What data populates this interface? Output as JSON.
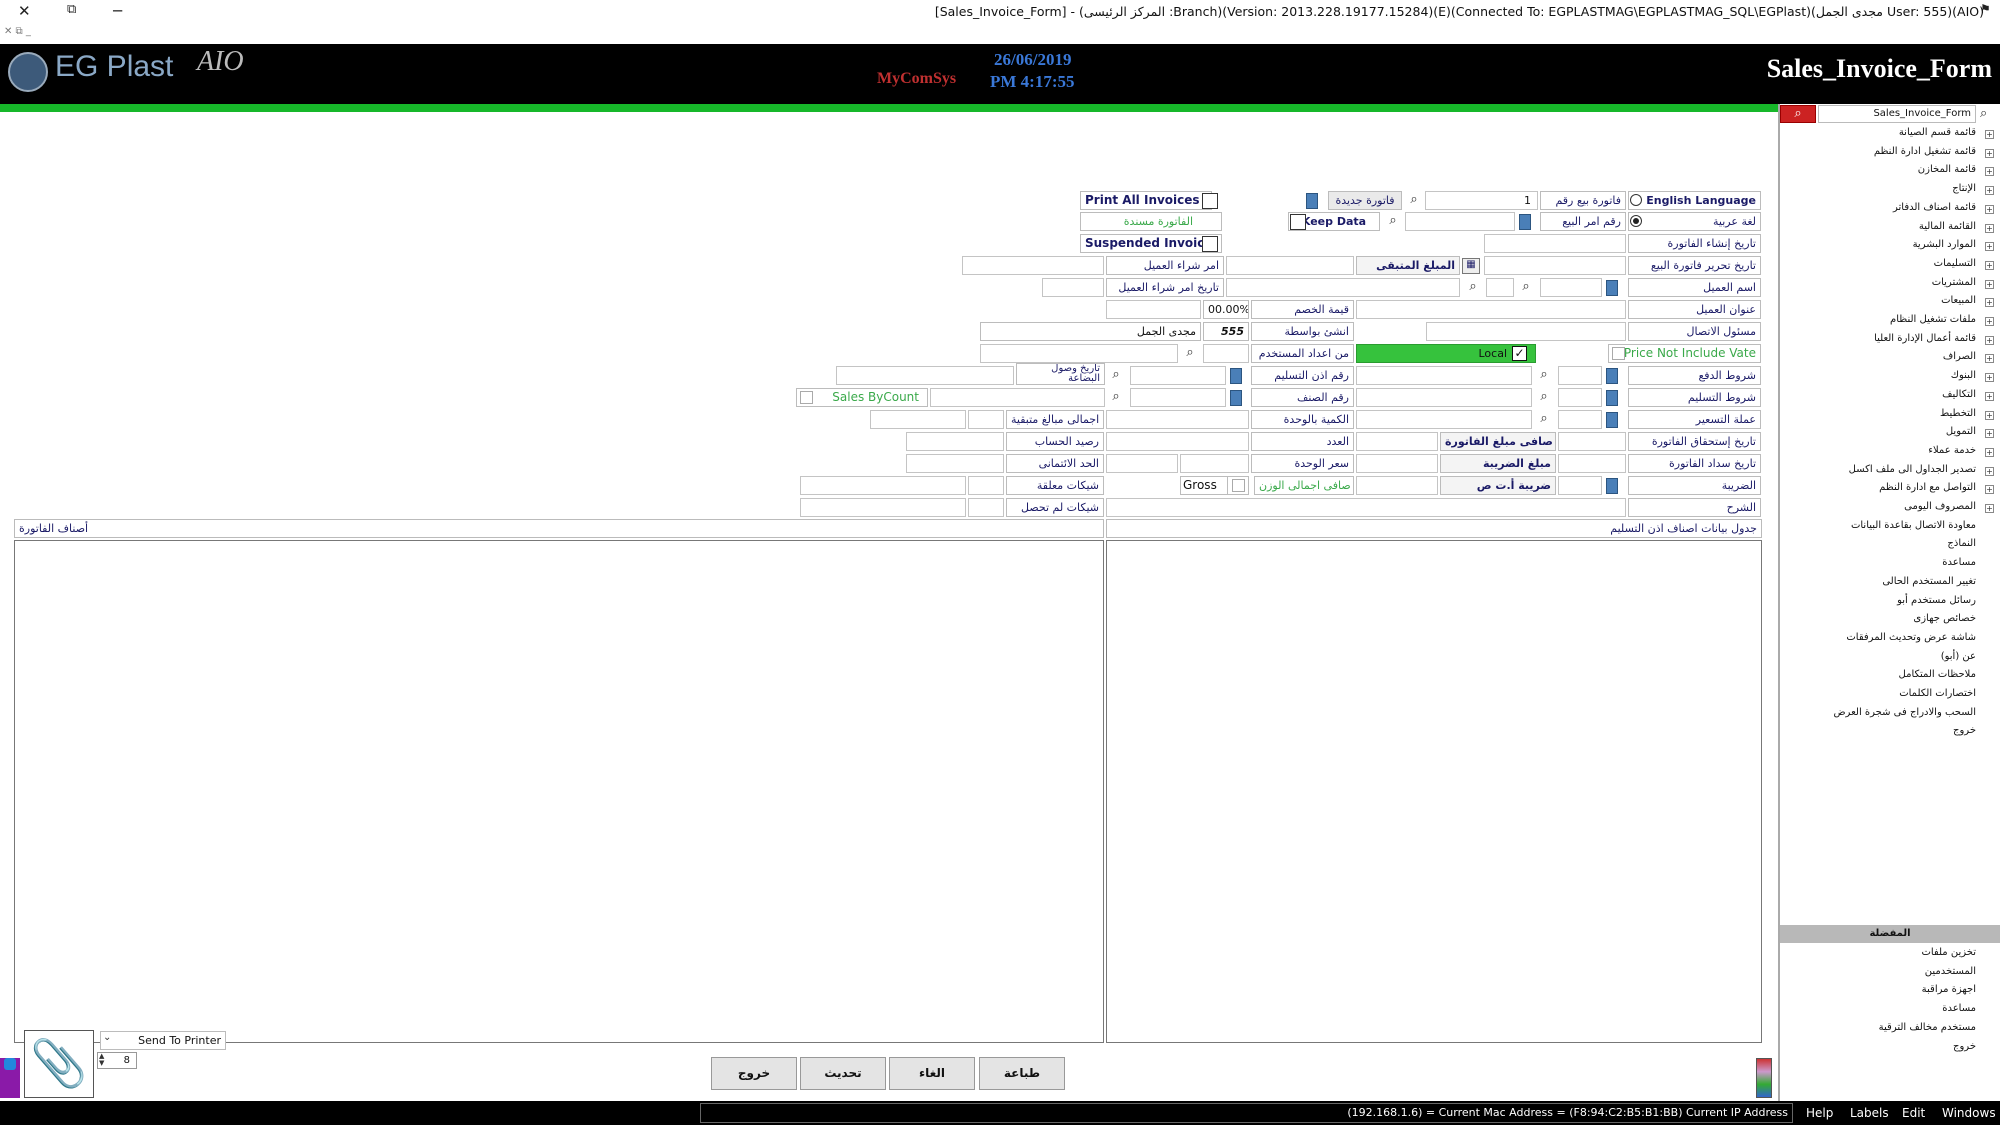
{
  "window": {
    "title": "[Sales_Invoice_Form] - (المركز الرئيسى :Branch)(Version: 2013.228.19177.15284)(E)(Connected To: EGPLASTMAG\\EGPLASTMAG_SQL\\EGPlast)(مجدى الجمل User: 555)(AIO)"
  },
  "header": {
    "logo": "EG Plast",
    "logo_suffix": "AIO",
    "brand2": "MyComSys",
    "date": "26/06/2019",
    "time": "PM 4:17:55",
    "form_title": "Sales_Invoice_Form"
  },
  "colors": {
    "accent_green": "#17b82a",
    "banner": "#000000",
    "date_blue": "#3a78d8"
  },
  "form": {
    "english_language": "English Language",
    "arabic_language": "لغة عربية",
    "invoice_no_label": "فاتورة بيع رقم",
    "invoice_no_value": "1",
    "order_no_label": "رقم امر البيع",
    "new_invoice": "فاتورة جديدة",
    "keep_data": "Keep Data",
    "print_all": "Print All Invoices",
    "linked_invoice": "الفاتورة مسندة",
    "suspended": "Suspended Invoice",
    "create_date": "تاريخ إنشاء الفاتورة",
    "edit_date": "تاريخ تحرير فاتورة البيع",
    "remaining": "المبلغ المتبقى",
    "customer_po": "امر شراء العميل",
    "customer_name": "اسم العميل",
    "po_date": "تاريخ امر شراء العميل",
    "customer_address": "عنوان العميل",
    "discount_value": "قيمة الخصم",
    "discount_pct": "00.00%",
    "contact": "مسئول الاتصال",
    "created_by": "انشئ بواسطة",
    "user_code": "555",
    "user_name": "مجدى الجمل",
    "price_no_vat": "Price Not Include Vate",
    "local": "Local",
    "from_user_settings": "من اعداد المستخدم",
    "payment_terms": "شروط الدفع",
    "delivery_no": "رقم اذن التسليم",
    "arrival_date": "تاريخ وصول البضاعة",
    "delivery_terms": "شروط التسليم",
    "item_no": "رقم الصنف",
    "sales_by_count": "Sales ByCount",
    "pricing_currency": "عملة التسعير",
    "qty_per_unit": "الكمية بالوحدة",
    "total_remaining": "اجمالى مبالغ متبقية",
    "due_date": "تاريخ إستحقاق الفاتورة",
    "net_invoice": "صافى مبلغ الفاتورة",
    "count": "العدد",
    "account_balance": "رصيد الحساب",
    "payment_date": "تاريخ سداد الفاتورة",
    "tax_amount": "مبلغ الضريبة",
    "unit_price": "سعر الوحدة",
    "credit_limit": "الحد الائتمانى",
    "tax": "الضريبة",
    "tax_atc": "ضريبة أ.ت ص",
    "net_total_weight": "صافى اجمالى الوزن",
    "gross": "Gross",
    "suspended_checks": "شيكات معلقة",
    "notes": "الشرح",
    "uncollected_checks": "شيكات لم تحصل",
    "delivery_items_table": "جدول بيانات اصناف اذن التسليم",
    "invoice_items": "أصناف الفاتورة",
    "send_to_printer": "Send To Printer",
    "copies": "8"
  },
  "buttons": {
    "print": "طباعة",
    "cancel": "الغاء",
    "update": "تحديث",
    "exit": "خروج"
  },
  "sidebar": {
    "search_value": "Sales_Invoice_Form",
    "tree_items": [
      "قائمة قسم الصيانة",
      "قائمة تشغيل ادارة النظم",
      "قائمة المخازن",
      "الإنتاج",
      "قائمة اصناف الدفاتر",
      "القائمة المالية",
      "الموارد البشرية",
      "التسليمات",
      "المشتريات",
      "المبيعات",
      "ملفات تشغيل النظام",
      "قائمة أعمال الإدارة العليا",
      "الصراف",
      "البنوك",
      "التكاليف",
      "التخطيط",
      "التمويل",
      "خدمة عملاء",
      "تصدير الجداول الى ملف اكسل",
      "التواصل مع ادارة النظم",
      "المصروف اليومى",
      "معاودة الاتصال بقاعدة البيانات",
      "النماذج",
      "مساعدة",
      "تغيير المستخدم الحالى",
      "رسائل مستخدم أبو",
      "خصائص جهازى",
      "شاشة عرض وتحديث المرفقات",
      "عن (أبو)",
      "ملاحظات المتكامل",
      "اختصارات الكلمات",
      "السحب والادراج فى شجرة العرض",
      "خروج"
    ],
    "favorites_title": "المفضلة",
    "favorites": [
      "تخزين ملفات",
      "المستخدمين",
      "اجهزة مراقبة",
      "مساعدة",
      "مستخدم مخالف الترقية",
      "خروج"
    ]
  },
  "statusbar": {
    "info": "(192.168.1.6) = Current Mac Address = (F8:94:C2:B5:B1:BB) Current IP Address",
    "menu": [
      "Help",
      "Labels",
      "Edit",
      "Windows"
    ]
  }
}
